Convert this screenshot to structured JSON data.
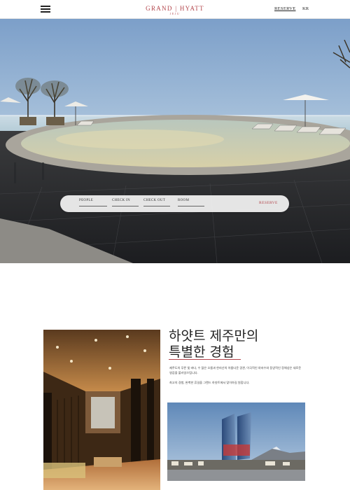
{
  "header": {
    "logo_main": "GRAND | HYATT",
    "logo_sub": "JEJU",
    "reserve_label": "RESERVE",
    "language_label": "KR"
  },
  "booking": {
    "people_label": "PEOPLE",
    "checkin_label": "CHECK IN",
    "checkout_label": "CHECK OUT",
    "room_label": "ROOM",
    "reserve_label": "RESERVE"
  },
  "intro": {
    "headline_line1": "하얏트 제주만의",
    "headline_line2": "특별한 경험",
    "paragraph1": "제주도의 푸른 빛 바다, 수 많은 오름과 한라산의 아름다운 경관, 이국적인 야자수와 동양적인 정체성은 새로운 영감을 불러일으킵니다.",
    "paragraph2": "최고의 경험, 완벽한 휴일을 그랜드 하얏트에서 맞이하길 원합니다."
  },
  "colors": {
    "brand": "#b2444a",
    "text": "#222222"
  },
  "icons": {
    "menu": "hamburger-menu-icon"
  }
}
